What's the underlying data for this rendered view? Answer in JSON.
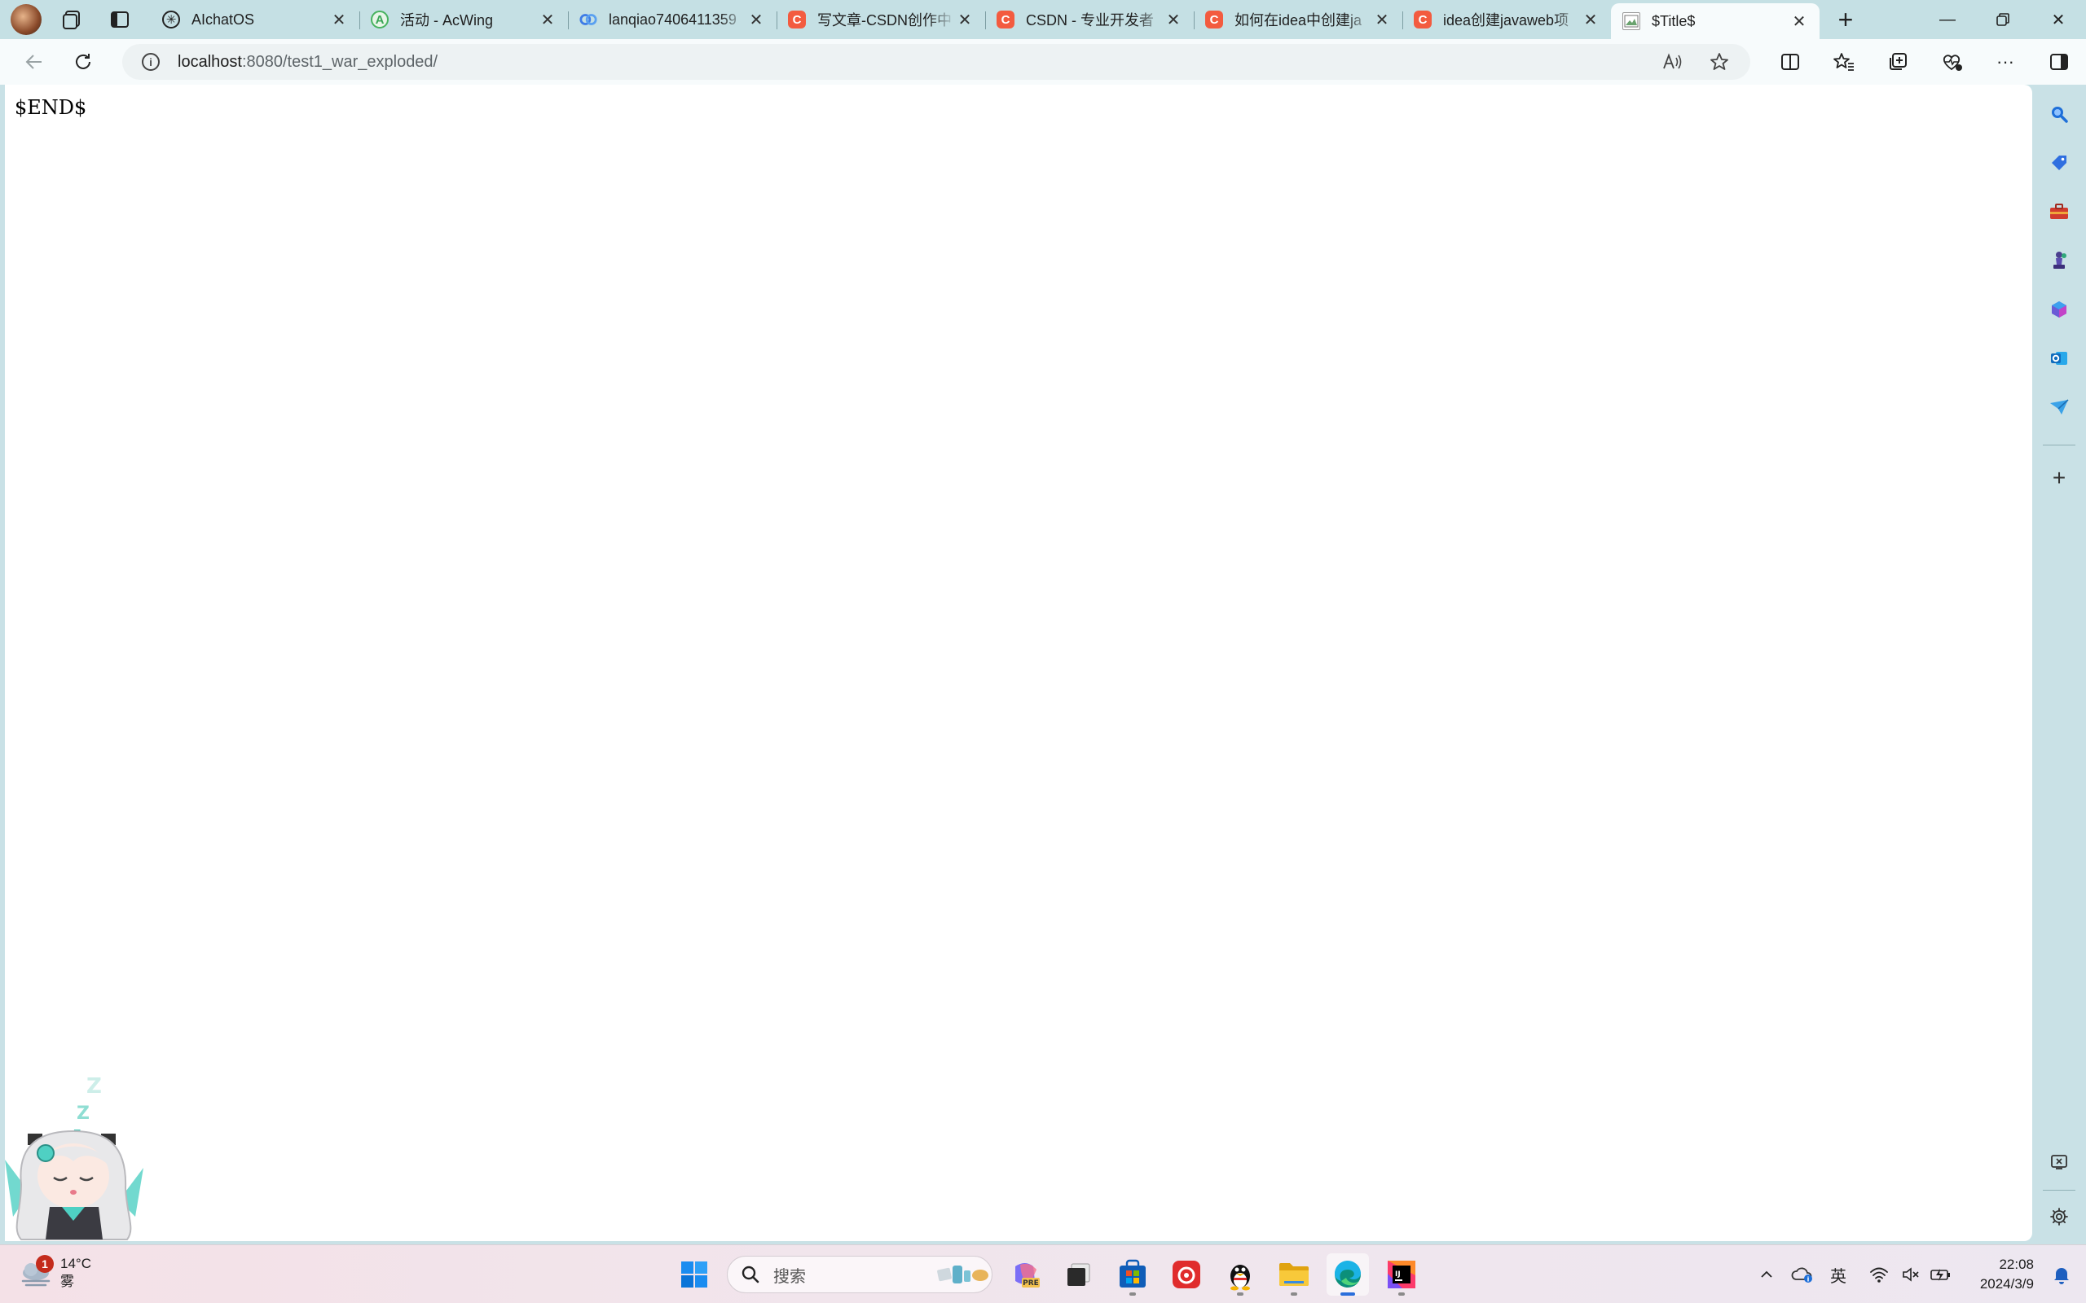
{
  "browser": {
    "tabs": [
      {
        "title": "AIchatOS",
        "favicon": "openai-icon",
        "active": false
      },
      {
        "title": "活动 - AcWing",
        "favicon": "acwing-icon",
        "active": false
      },
      {
        "title": "lanqiao7406411359",
        "favicon": "lanqiao-icon",
        "active": false
      },
      {
        "title": "写文章-CSDN创作中",
        "favicon": "csdn-icon",
        "active": false
      },
      {
        "title": "CSDN - 专业开发者",
        "favicon": "csdn-icon",
        "active": false
      },
      {
        "title": "如何在idea中创建ja",
        "favicon": "csdn-icon",
        "active": false
      },
      {
        "title": "idea创建javaweb项",
        "favicon": "csdn-icon",
        "active": false
      },
      {
        "title": "$Title$",
        "favicon": "page-icon",
        "active": true
      }
    ],
    "address": {
      "host": "localhost",
      "path": ":8080/test1_war_exploded/"
    }
  },
  "page": {
    "body_text": "$END$"
  },
  "taskbar": {
    "weather": {
      "temp": "14°C",
      "condition": "雾",
      "badge": "1"
    },
    "search_placeholder": "搜索",
    "ime": "英",
    "clock": {
      "time": "22:08",
      "date": "2024/3/9"
    }
  },
  "colors": {
    "tabstrip": "#c5e0e4",
    "csdn": "#f35b3f",
    "edge_accent": "#2a6edb"
  }
}
